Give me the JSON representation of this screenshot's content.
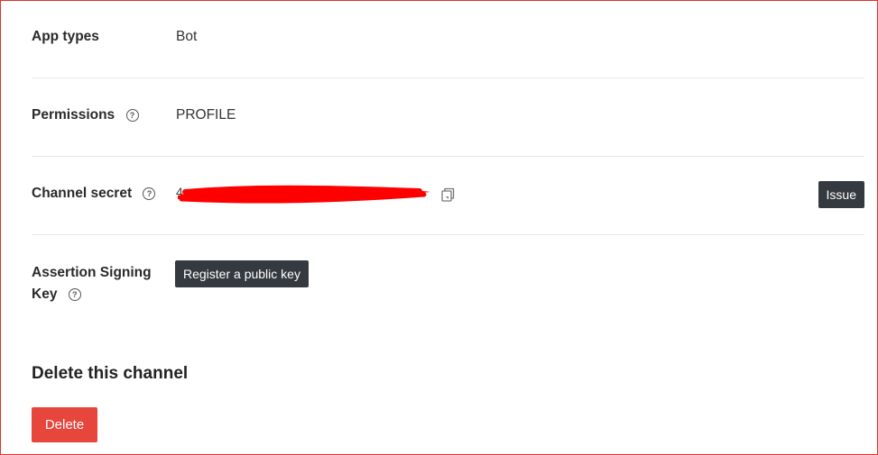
{
  "rows": {
    "app_types": {
      "label": "App types",
      "value": "Bot"
    },
    "permissions": {
      "label": "Permissions",
      "value": "PROFILE"
    },
    "channel_secret": {
      "label": "Channel secret",
      "value": "4",
      "issue_label": "Issue"
    },
    "assertion_key": {
      "label_line1": "Assertion Signing",
      "label_line2": "Key",
      "register_label": "Register a public key"
    }
  },
  "delete_section": {
    "title": "Delete this channel",
    "button_label": "Delete"
  },
  "icons": [
    "help-icon",
    "copy-icon"
  ],
  "colors": {
    "frame": "#e0352b",
    "dark_button": "#353a40",
    "delete_button": "#e7463d",
    "redaction": "#ff0000"
  }
}
